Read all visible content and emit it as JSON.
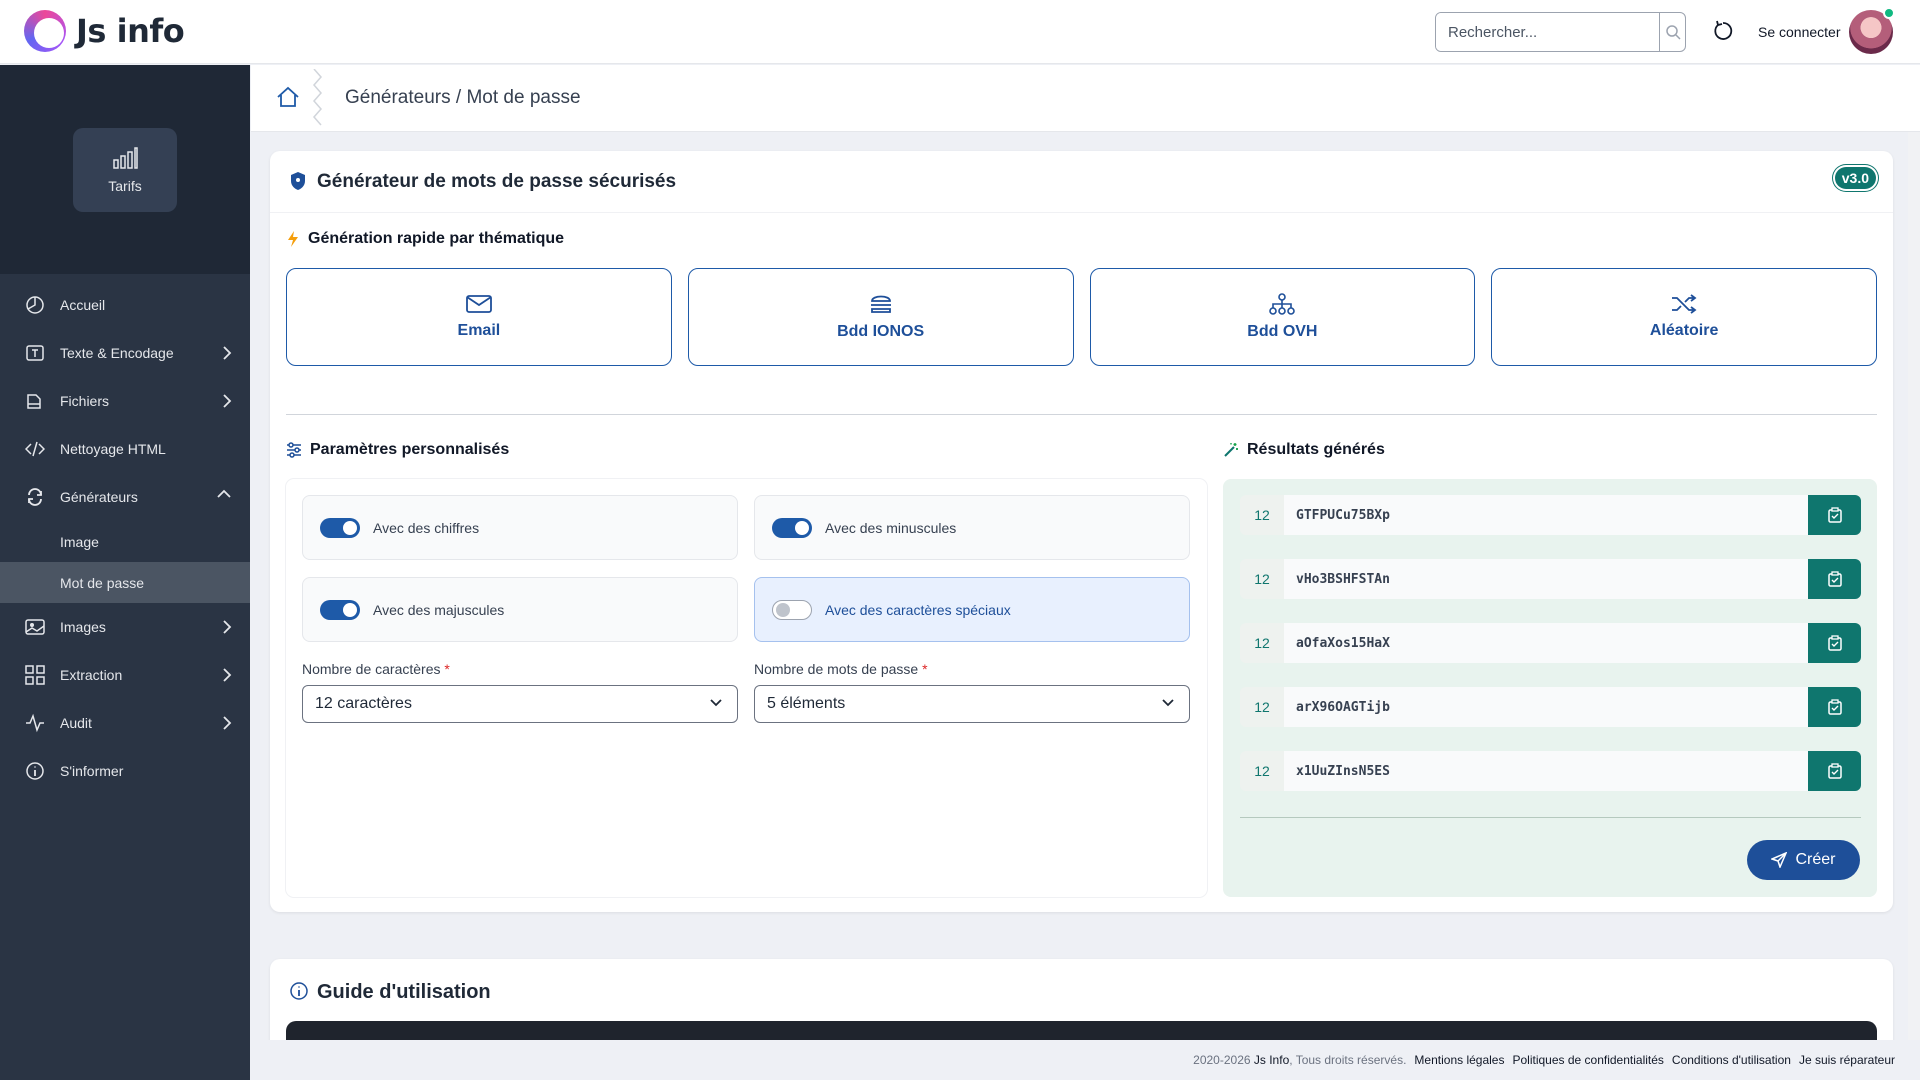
{
  "header": {
    "logo_text": "Js info",
    "search_placeholder": "Rechercher...",
    "login_label": "Se connecter"
  },
  "sidebar": {
    "tarifs_label": "Tarifs",
    "items": [
      {
        "label": "Accueil",
        "icon": "pie-chart-icon"
      },
      {
        "label": "Texte & Encodage",
        "icon": "text-encoding-icon"
      },
      {
        "label": "Fichiers",
        "icon": "folder-icon"
      },
      {
        "label": "Nettoyage HTML",
        "icon": "code-icon"
      },
      {
        "label": "Générateurs",
        "icon": "refresh-icon"
      },
      {
        "label": "Images",
        "icon": "image-icon"
      },
      {
        "label": "Extraction",
        "icon": "grid-icon"
      },
      {
        "label": "Audit",
        "icon": "activity-icon"
      },
      {
        "label": "S'informer",
        "icon": "info-icon"
      }
    ],
    "sub_items": [
      "Image",
      "Mot de passe"
    ]
  },
  "breadcrumb": "Générateurs / Mot de passe",
  "generator": {
    "title": "Générateur de mots de passe sécurisés",
    "version": "v3.0",
    "quick_title": "Génération rapide par thématique",
    "quick_buttons": [
      "Email",
      "Bdd IONOS",
      "Bdd OVH",
      "Aléatoire"
    ],
    "params_title": "Paramètres personnalisés",
    "options": [
      {
        "label": "Avec des chiffres",
        "on": true
      },
      {
        "label": "Avec des minuscules",
        "on": true
      },
      {
        "label": "Avec des majuscules",
        "on": true
      },
      {
        "label": "Avec des caractères spéciaux",
        "on": false
      }
    ],
    "length_label": "Nombre de caractères",
    "length_value": "12 caractères",
    "count_label": "Nombre de mots de passe",
    "count_value": "5 éléments",
    "required_mark": "*",
    "results_title": "Résultats générés",
    "results": [
      {
        "len": "12",
        "value": "GTFPUCu75BXp"
      },
      {
        "len": "12",
        "value": "vHo3BSHFSTAn"
      },
      {
        "len": "12",
        "value": "aOfaXos15HaX"
      },
      {
        "len": "12",
        "value": "arX96OAGTijb"
      },
      {
        "len": "12",
        "value": "x1UuZInsN5ES"
      }
    ],
    "create_label": "Créer"
  },
  "guide": {
    "title": "Guide d'utilisation"
  },
  "footer": {
    "copyright": "2020-2026",
    "brand": "Js Info",
    "rights": ", Tous droits réservés.",
    "links": [
      "Mentions légales",
      "Politiques de confidentialités",
      "Conditions d'utilisation",
      "Je suis réparateur"
    ]
  },
  "colors": {
    "sidebar": "#2a3444",
    "primary": "#1e5aa8",
    "teal": "#0f766e"
  }
}
